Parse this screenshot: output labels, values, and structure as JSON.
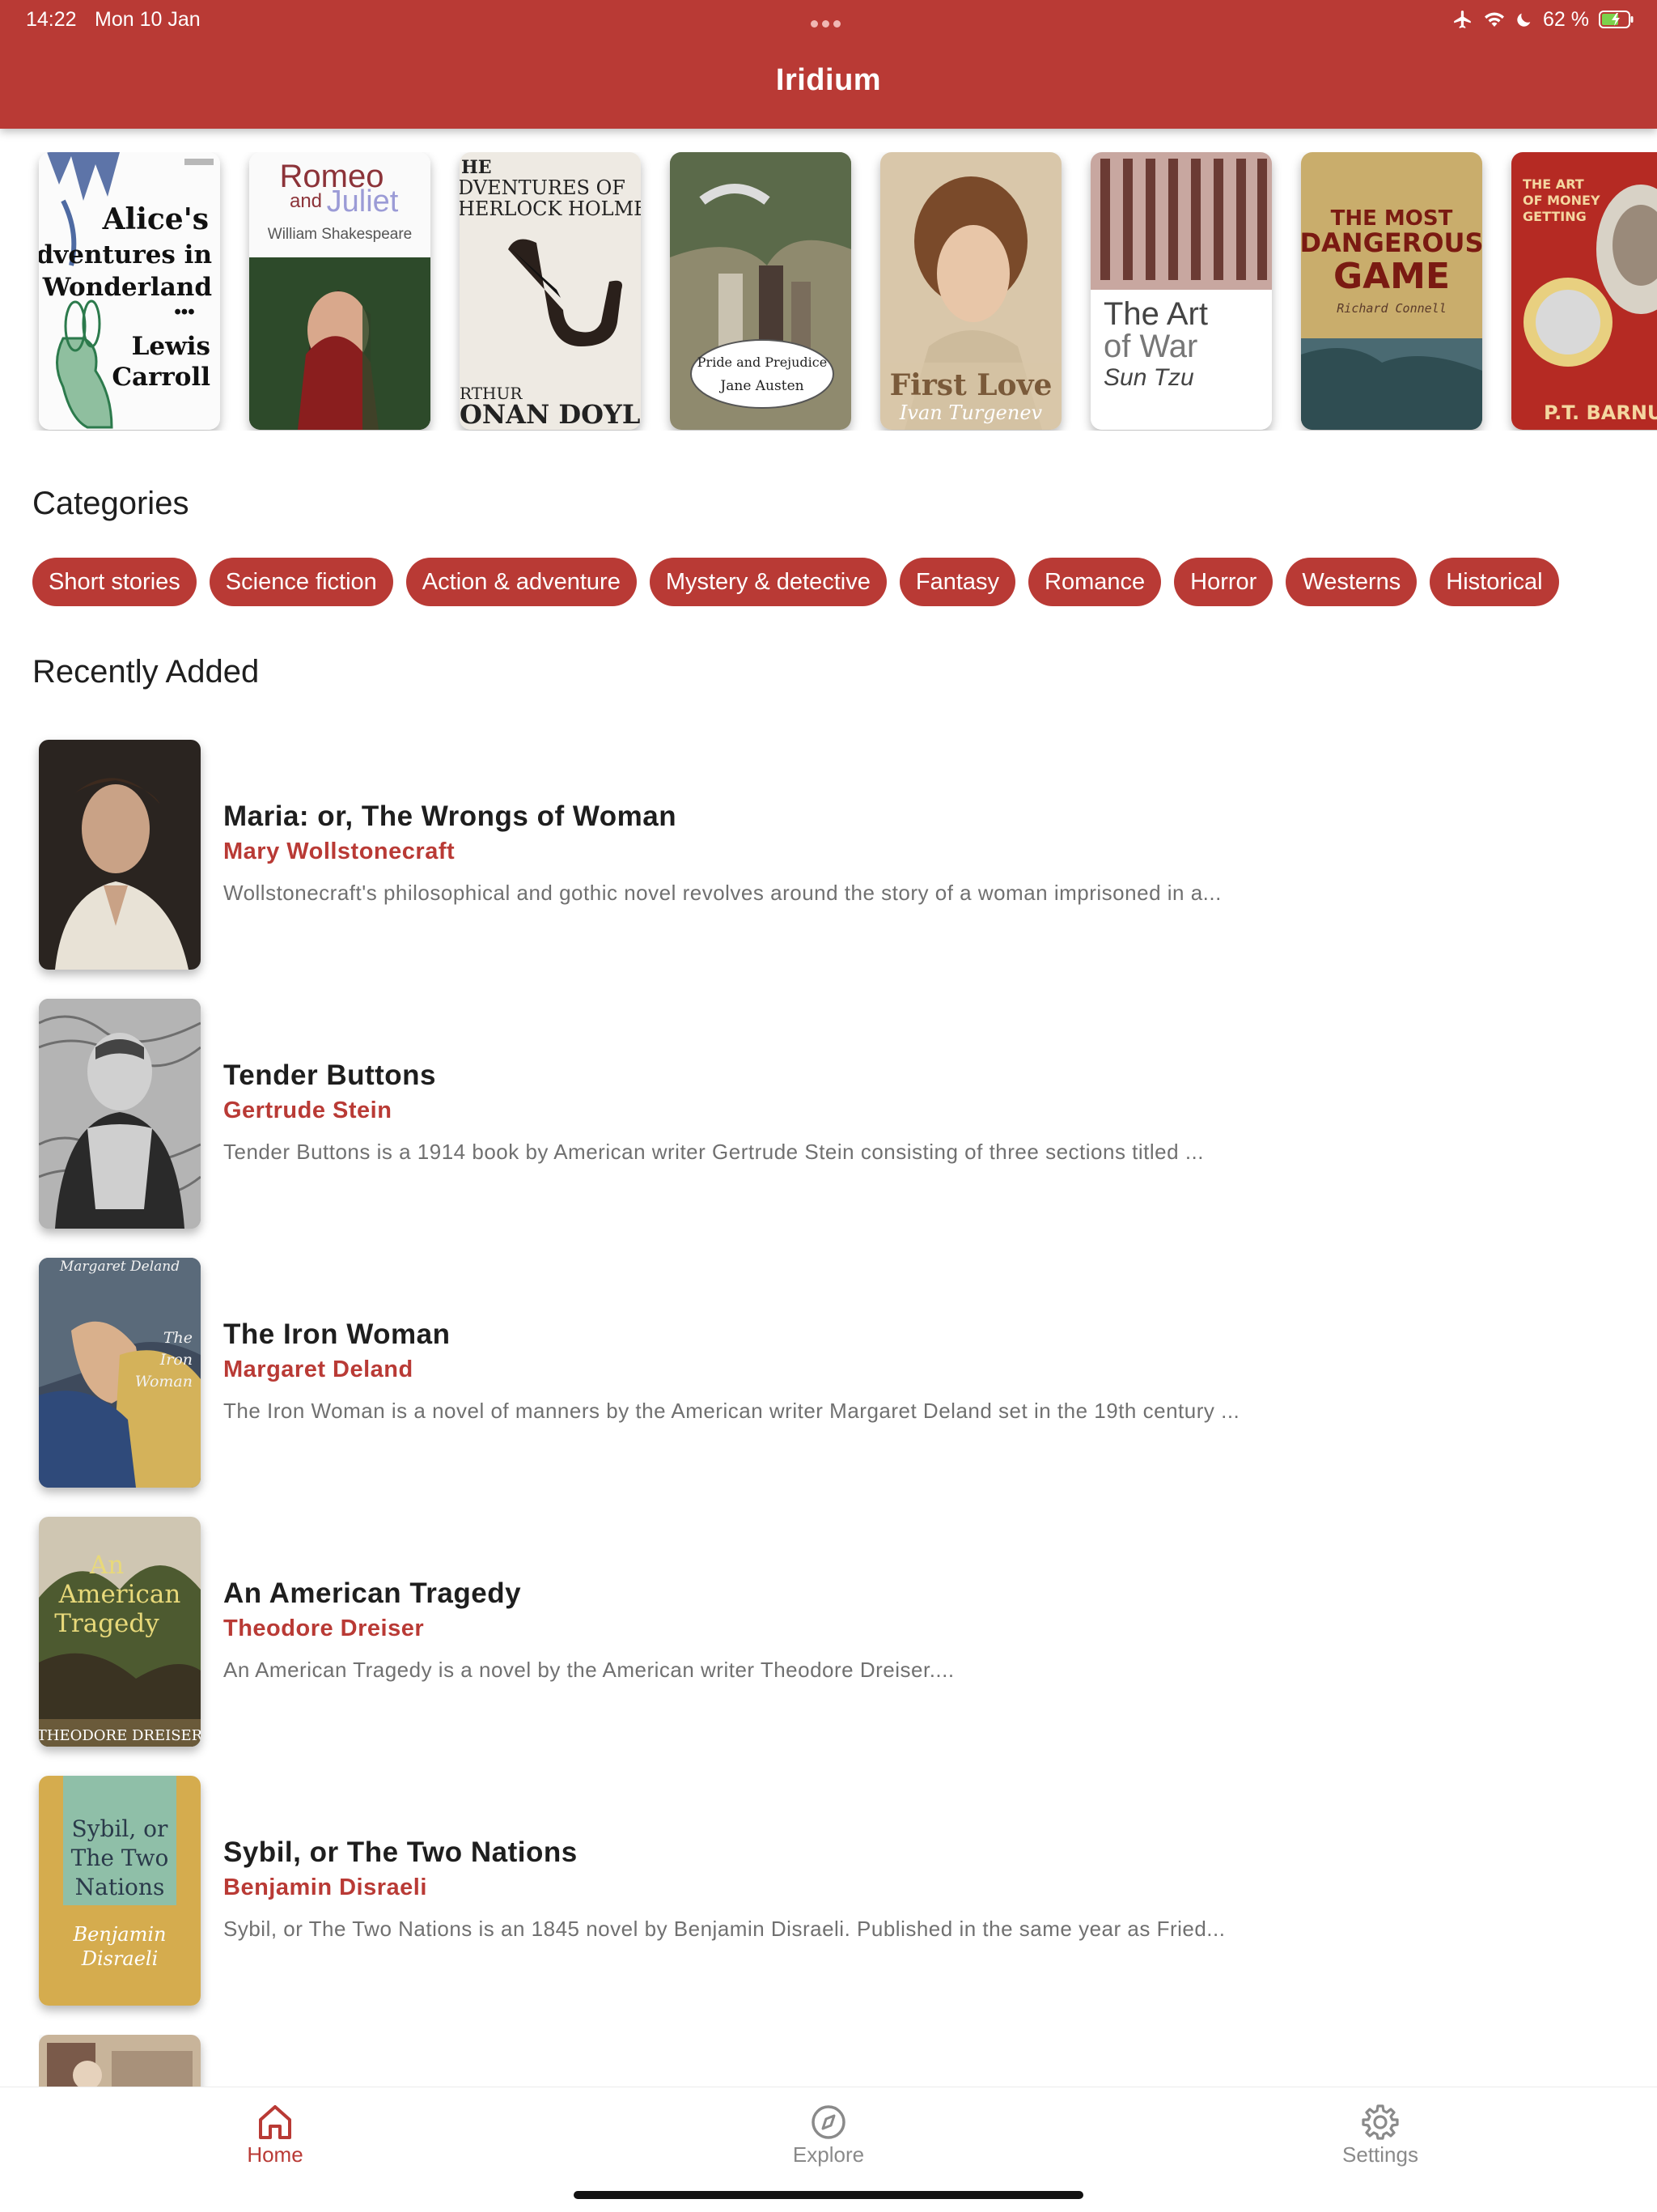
{
  "status_bar": {
    "time": "14:22",
    "date": "Mon 10 Jan",
    "battery": "62 %"
  },
  "app": {
    "title": "Iridium"
  },
  "featured": [
    {
      "title": "Alice's Adventures in Wonderland",
      "cover_text": [
        "Alice's",
        "Adventures in",
        "Wonderland",
        "•••",
        "Lewis",
        "Carroll"
      ],
      "author": "Lewis Carroll"
    },
    {
      "title": "Romeo and Juliet",
      "cover_text": [
        "Romeo",
        "and",
        "Juliet",
        "William Shakespeare"
      ],
      "author": "William Shakespeare"
    },
    {
      "title": "The Adventures of Sherlock Holmes",
      "cover_text": [
        "HE",
        "DVENTURES OF",
        "HERLOCK HOLME",
        "RTHUR",
        "ONAN DOYL"
      ],
      "author": "Arthur Conan Doyle"
    },
    {
      "title": "Pride and Prejudice",
      "cover_text": [
        "Pride and Prejudice",
        "Jane Austen"
      ],
      "author": "Jane Austen"
    },
    {
      "title": "First Love",
      "cover_text": [
        "First Love",
        "Ivan Turgenev"
      ],
      "author": "Ivan Turgenev"
    },
    {
      "title": "The Art of War",
      "cover_text": [
        "The Art",
        "of War",
        "Sun Tzu"
      ],
      "author": "Sun Tzu"
    },
    {
      "title": "The Most Dangerous Game",
      "cover_text": [
        "THE MOST",
        "DANGEROUS",
        "GAME",
        "Richard Connell"
      ],
      "author": "Richard Connell"
    },
    {
      "title": "The Art of Money Getting",
      "cover_text": [
        "THE ART",
        "OF MONEY",
        "GETTING",
        "P.T. BARNUM"
      ],
      "author": "P.T. Barnum"
    }
  ],
  "categories": {
    "title": "Categories",
    "items": [
      "Short stories",
      "Science fiction",
      "Action & adventure",
      "Mystery & detective",
      "Fantasy",
      "Romance",
      "Horror",
      "Westerns",
      "Historical"
    ]
  },
  "recent": {
    "title": "Recently Added",
    "books": [
      {
        "title": "Maria: or, The Wrongs of Woman",
        "author": "Mary Wollstonecraft",
        "description": "Wollstonecraft's philosophical and gothic novel revolves around the story of a woman imprisoned in a..."
      },
      {
        "title": "Tender Buttons",
        "author": "Gertrude Stein",
        "description": "Tender Buttons is a 1914 book by American writer Gertrude Stein consisting of three sections titled ..."
      },
      {
        "title": "The Iron Woman",
        "author": "Margaret Deland",
        "description": "The Iron Woman is a novel of manners by the American writer Margaret Deland set in the 19th century ...",
        "cover_text": [
          "Margaret Deland",
          "The",
          "Iron",
          "Woman"
        ]
      },
      {
        "title": "An American Tragedy",
        "author": "Theodore Dreiser",
        "description": "An American Tragedy is a novel by the American writer Theodore Dreiser....",
        "cover_text": [
          "An",
          "American",
          "Tragedy",
          "THEODORE DREISER"
        ]
      },
      {
        "title": "Sybil, or The Two Nations",
        "author": "Benjamin Disraeli",
        "description": "Sybil, or The Two Nations is an 1845 novel by Benjamin Disraeli. Published in the same year as Fried...",
        "cover_text": [
          "Sybil, or",
          "The Two",
          "Nations",
          "Benjamin",
          "Disraeli"
        ]
      }
    ]
  },
  "tabs": [
    {
      "label": "Home",
      "icon": "home-icon",
      "active": true
    },
    {
      "label": "Explore",
      "icon": "compass-icon",
      "active": false
    },
    {
      "label": "Settings",
      "icon": "gear-icon",
      "active": false
    }
  ],
  "colors": {
    "accent": "#b93a35",
    "tab_inactive": "#8a8a8a",
    "description_text": "#707070"
  }
}
